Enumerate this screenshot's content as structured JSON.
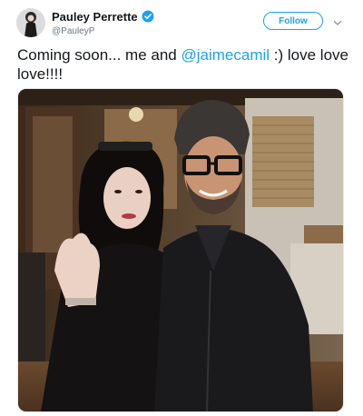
{
  "user": {
    "display_name": "Pauley Perrette",
    "handle": "@PauleyP",
    "verified": true,
    "avatar_icon": "profile-photo"
  },
  "actions": {
    "follow_label": "Follow",
    "menu_icon": "chevron-down-icon"
  },
  "tweet": {
    "text_before": "Coming soon... me and ",
    "mention": "@jaimecamil",
    "text_after": "  :) love love love!!!!"
  },
  "media": {
    "type": "photo"
  },
  "colors": {
    "accent": "#1da1f2",
    "text": "#14171a",
    "secondary": "#657786"
  }
}
